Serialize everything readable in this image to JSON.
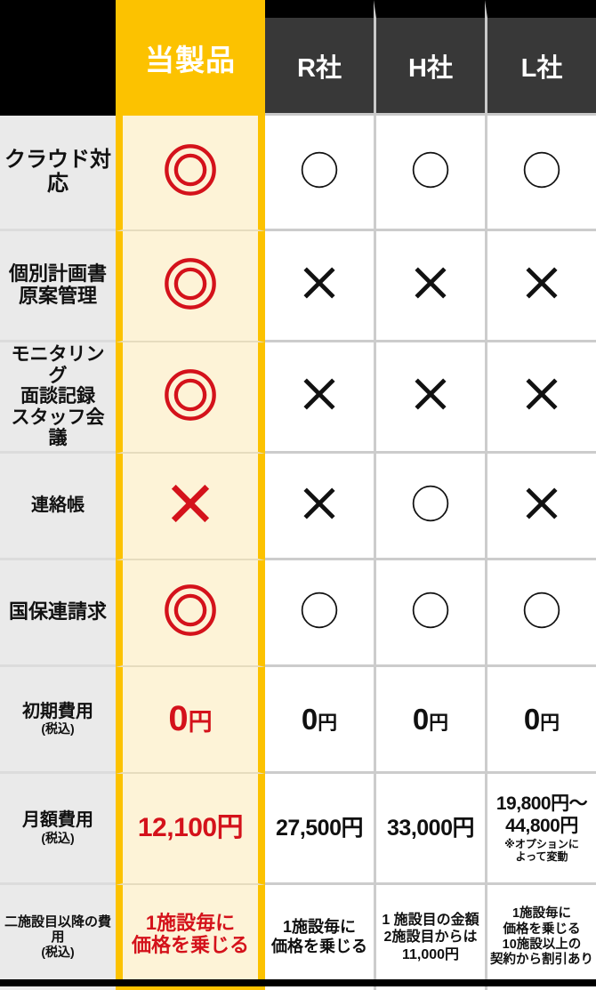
{
  "table": {
    "columns": [
      {
        "key": "label",
        "label": "",
        "type": "label"
      },
      {
        "key": "own",
        "label": "当製品",
        "type": "highlight"
      },
      {
        "key": "r",
        "label": "R社",
        "type": "rival"
      },
      {
        "key": "h",
        "label": "H社",
        "type": "rival"
      },
      {
        "key": "l",
        "label": "L社",
        "type": "rival"
      }
    ],
    "rows": [
      {
        "label_main": "クラウド対応",
        "label_sub": "",
        "own": {
          "mark": "double-circle",
          "text": ""
        },
        "r": {
          "mark": "circle",
          "text": ""
        },
        "h": {
          "mark": "circle",
          "text": ""
        },
        "l": {
          "mark": "circle",
          "text": ""
        }
      },
      {
        "label_main": "個別計画書\n原案管理",
        "label_sub": "",
        "own": {
          "mark": "double-circle",
          "text": ""
        },
        "r": {
          "mark": "cross",
          "text": ""
        },
        "h": {
          "mark": "cross",
          "text": ""
        },
        "l": {
          "mark": "cross",
          "text": ""
        }
      },
      {
        "label_main": "モニタリング\n面談記録\nスタッフ会議",
        "label_sub": "",
        "own": {
          "mark": "double-circle",
          "text": ""
        },
        "r": {
          "mark": "cross",
          "text": ""
        },
        "h": {
          "mark": "cross",
          "text": ""
        },
        "l": {
          "mark": "cross",
          "text": ""
        }
      },
      {
        "label_main": "連絡帳",
        "label_sub": "",
        "own": {
          "mark": "cross-red",
          "text": ""
        },
        "r": {
          "mark": "cross",
          "text": ""
        },
        "h": {
          "mark": "circle",
          "text": ""
        },
        "l": {
          "mark": "cross",
          "text": ""
        }
      },
      {
        "label_main": "国保連請求",
        "label_sub": "",
        "own": {
          "mark": "double-circle",
          "text": ""
        },
        "r": {
          "mark": "circle",
          "text": ""
        },
        "h": {
          "mark": "circle",
          "text": ""
        },
        "l": {
          "mark": "circle",
          "text": ""
        }
      },
      {
        "label_main": "初期費用",
        "label_sub": "(税込)",
        "own": {
          "mark": "",
          "amount": "0",
          "unit": "円"
        },
        "r": {
          "mark": "",
          "amount": "0",
          "unit": "円"
        },
        "h": {
          "mark": "",
          "amount": "0",
          "unit": "円"
        },
        "l": {
          "mark": "",
          "amount": "0",
          "unit": "円"
        }
      },
      {
        "label_main": "月額費用",
        "label_sub": "(税込)",
        "own": {
          "mark": "",
          "text": "12,100円"
        },
        "r": {
          "mark": "",
          "text": "27,500円"
        },
        "h": {
          "mark": "",
          "text": "33,000円"
        },
        "l": {
          "mark": "",
          "text": "19,800円〜\n44,800円",
          "note": "※オプションに\nよって変動"
        }
      },
      {
        "label_main": "二施設目以降の費用",
        "label_sub": "(税込)",
        "own": {
          "mark": "",
          "text": "1施設毎に\n価格を乗じる"
        },
        "r": {
          "mark": "",
          "text": "1施設毎に\n価格を乗じる"
        },
        "h": {
          "mark": "",
          "text": "1 施設目の金額\n2施設目からは\n11,000円"
        },
        "l": {
          "mark": "",
          "text": "1施設毎に\n価格を乗じる\n10施設以上の\n契約から割引あり"
        }
      }
    ]
  },
  "colors": {
    "highlight": "#FCC200",
    "highlight_fill": "#FDF3D7",
    "accent_red": "#D4121B",
    "header_dark": "#383838",
    "label_bg": "#EAEAEA",
    "page_bg": "#000000",
    "grid_line": "#CCCCCC"
  },
  "marks": {
    "double-circle": "◎",
    "circle": "○",
    "cross": "×",
    "cross-red": "×"
  }
}
